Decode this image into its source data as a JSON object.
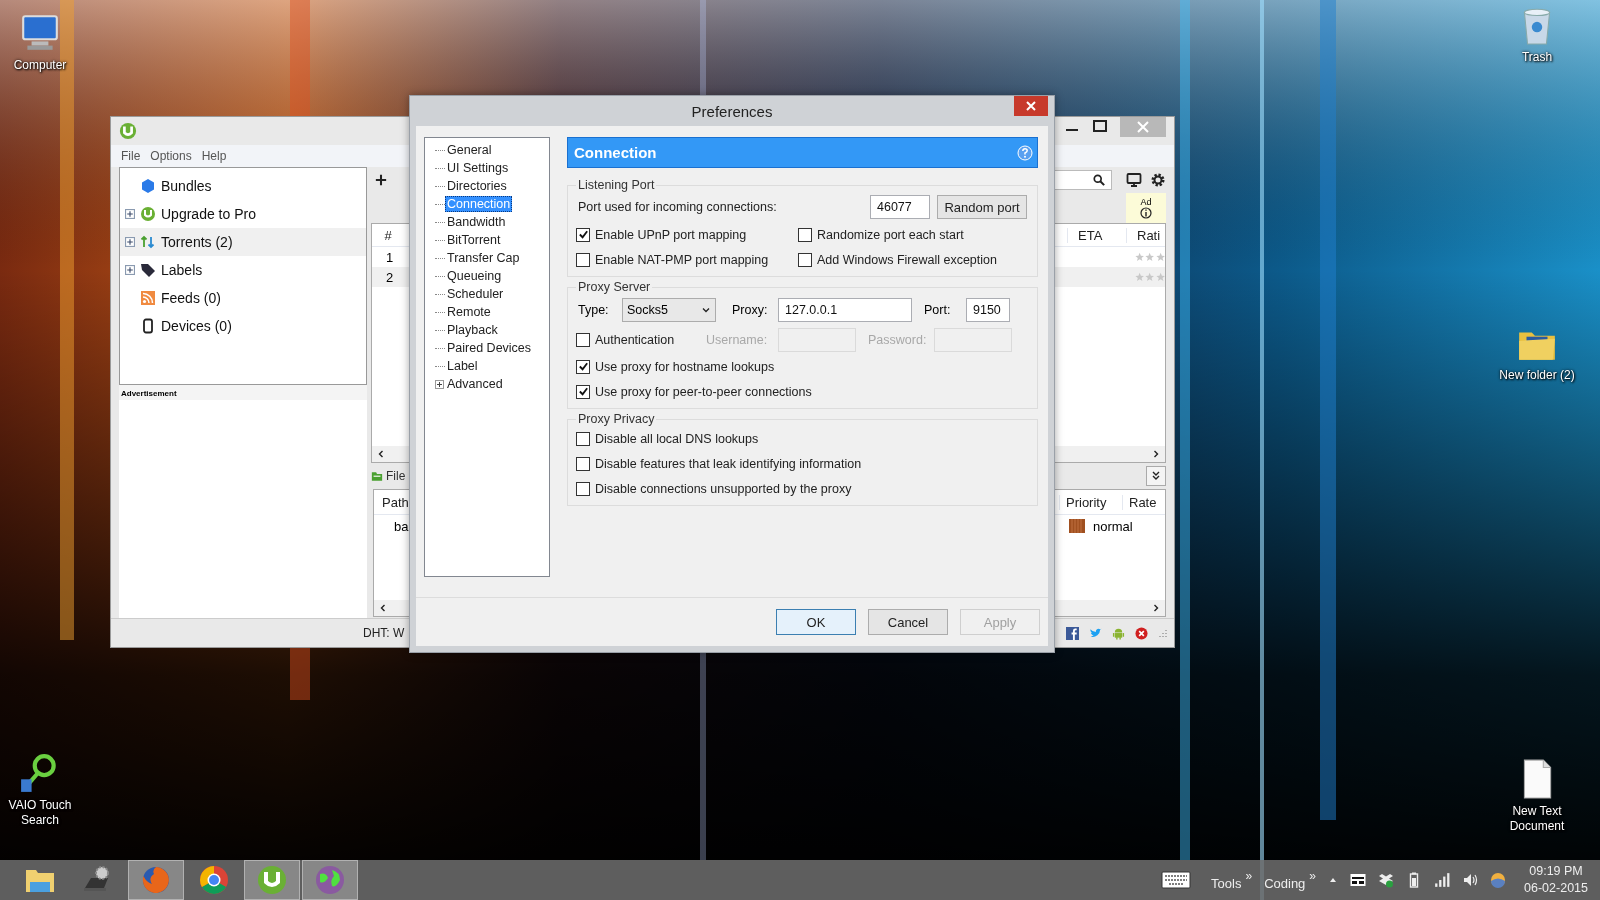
{
  "desktop_icons": [
    {
      "label": "Computer",
      "kind": "computer"
    },
    {
      "label": "VAIO Touch Search",
      "kind": "search"
    },
    {
      "label": "Trash",
      "kind": "trash"
    },
    {
      "label": "New folder (2)",
      "kind": "folder"
    },
    {
      "label": "New Text Document",
      "kind": "document"
    }
  ],
  "torrent_app": {
    "menu": [
      "File",
      "Options",
      "Help"
    ],
    "sidebar": [
      {
        "label": "Bundles",
        "expandable": false,
        "selected": false
      },
      {
        "label": "Upgrade to Pro",
        "expandable": true,
        "selected": false
      },
      {
        "label": "Torrents (2)",
        "expandable": true,
        "selected": true
      },
      {
        "label": "Labels",
        "expandable": true,
        "selected": false
      },
      {
        "label": "Feeds (0)",
        "expandable": false,
        "selected": false
      },
      {
        "label": "Devices (0)",
        "expandable": false,
        "selected": false
      }
    ],
    "advertisement": "Advertisement",
    "ad_badge": "Ad",
    "torrent_table": {
      "columns": [
        "#",
        "ETA",
        "Rati"
      ],
      "rows": [
        {
          "number": "1",
          "selected": false,
          "stars": 0
        },
        {
          "number": "2",
          "selected": true,
          "stars": 0
        }
      ]
    },
    "details_tab": "File",
    "files_table": {
      "columns": [
        "Path",
        "Priority",
        "Rate"
      ],
      "rows": [
        {
          "path": "ba",
          "priority": "normal"
        }
      ]
    },
    "status": "DHT: W"
  },
  "preferences": {
    "title": "Preferences",
    "nav": [
      {
        "label": "General",
        "selected": false,
        "expandable": false
      },
      {
        "label": "UI Settings",
        "selected": false,
        "expandable": false
      },
      {
        "label": "Directories",
        "selected": false,
        "expandable": false
      },
      {
        "label": "Connection",
        "selected": true,
        "expandable": false
      },
      {
        "label": "Bandwidth",
        "selected": false,
        "expandable": false
      },
      {
        "label": "BitTorrent",
        "selected": false,
        "expandable": false
      },
      {
        "label": "Transfer Cap",
        "selected": false,
        "expandable": false
      },
      {
        "label": "Queueing",
        "selected": false,
        "expandable": false
      },
      {
        "label": "Scheduler",
        "selected": false,
        "expandable": false
      },
      {
        "label": "Remote",
        "selected": false,
        "expandable": false
      },
      {
        "label": "Playback",
        "selected": false,
        "expandable": false
      },
      {
        "label": "Paired Devices",
        "selected": false,
        "expandable": false
      },
      {
        "label": "Label",
        "selected": false,
        "expandable": false
      },
      {
        "label": "Advanced",
        "selected": false,
        "expandable": true
      }
    ],
    "section": "Connection",
    "listening_port": {
      "title": "Listening Port",
      "port_label": "Port used for incoming connections:",
      "port": "46077",
      "random_button": "Random port",
      "options": [
        {
          "label": "Enable UPnP port mapping",
          "checked": true
        },
        {
          "label": "Randomize port each start",
          "checked": false
        },
        {
          "label": "Enable NAT-PMP port mapping",
          "checked": false
        },
        {
          "label": "Add Windows Firewall exception",
          "checked": false
        }
      ]
    },
    "proxy_server": {
      "title": "Proxy Server",
      "type_label": "Type:",
      "type": "Socks5",
      "proxy_label": "Proxy:",
      "proxy": "127.0.0.1",
      "port_label": "Port:",
      "port": "9150",
      "authentication": {
        "label": "Authentication",
        "checked": false
      },
      "username_label": "Username:",
      "password_label": "Password:",
      "credentials_disabled": true,
      "options": [
        {
          "label": "Use proxy for hostname lookups",
          "checked": true
        },
        {
          "label": "Use proxy for peer-to-peer connections",
          "checked": true
        }
      ]
    },
    "proxy_privacy": {
      "title": "Proxy Privacy",
      "options": [
        {
          "label": "Disable all local DNS lookups",
          "checked": false
        },
        {
          "label": "Disable features that leak identifying information",
          "checked": false
        },
        {
          "label": "Disable connections unsupported by the proxy",
          "checked": false
        }
      ]
    },
    "buttons": [
      {
        "label": "OK",
        "kind": "default",
        "disabled": false
      },
      {
        "label": "Cancel",
        "kind": "normal",
        "disabled": false
      },
      {
        "label": "Apply",
        "kind": "normal",
        "disabled": true
      }
    ]
  },
  "taskbar": {
    "apps": [
      {
        "kind": "explorer",
        "active": false
      },
      {
        "kind": "settings",
        "active": false
      },
      {
        "kind": "firefox",
        "active": true
      },
      {
        "kind": "chrome",
        "active": false
      },
      {
        "kind": "utorrent",
        "active": true
      },
      {
        "kind": "globe",
        "active": true
      }
    ],
    "toolbars": [
      {
        "label": "Tools",
        "chevron": "»"
      },
      {
        "label": "Coding",
        "chevron": "»"
      }
    ],
    "time": "09:19 PM",
    "date": "06-02-2015"
  }
}
